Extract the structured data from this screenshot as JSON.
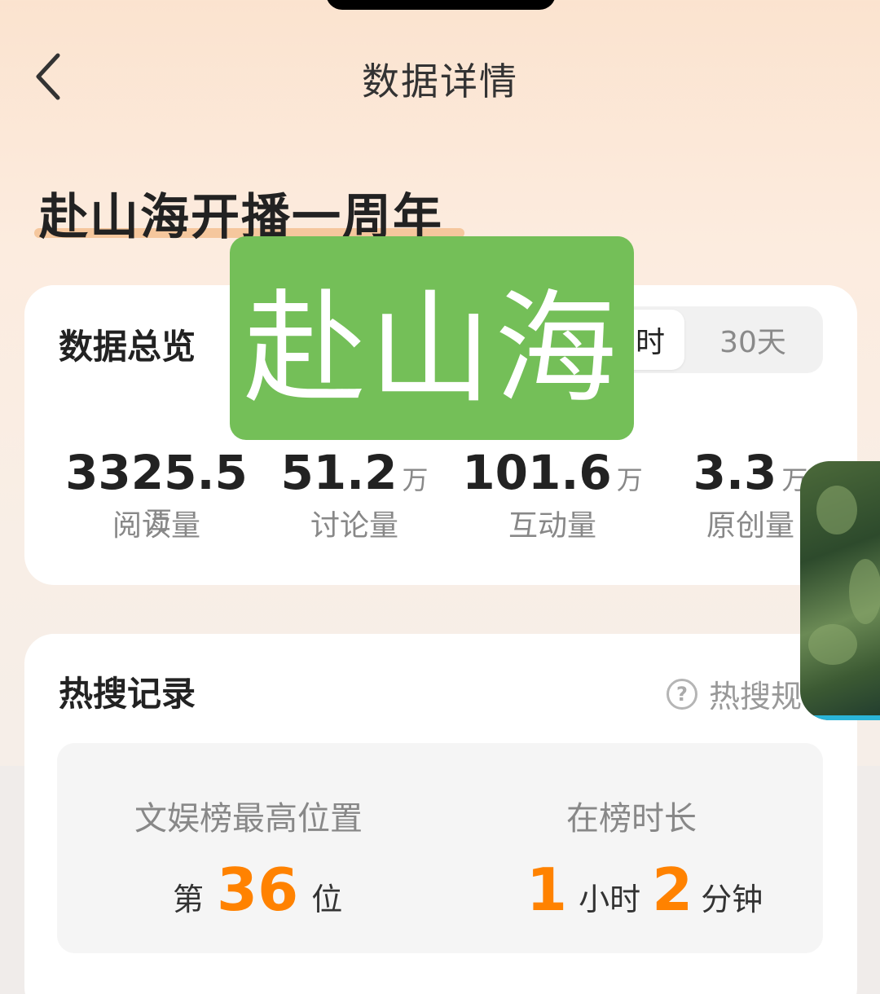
{
  "header": {
    "title": "数据详情"
  },
  "topic": {
    "title": "赴山海开播一周年"
  },
  "overview": {
    "title": "数据总览",
    "toggle": {
      "active_label": "时",
      "inactive_label": "30天"
    },
    "stats": [
      {
        "value": "3325.5",
        "unit": "万",
        "label": "阅读量"
      },
      {
        "value": "51.2",
        "unit": "万",
        "label": "讨论量"
      },
      {
        "value": "101.6",
        "unit": "万",
        "label": "互动量"
      },
      {
        "value": "3.3",
        "unit": "万",
        "label": "原创量"
      }
    ]
  },
  "hot_search": {
    "title": "热搜记录",
    "help_label": "热搜规",
    "rank_label": "文娱榜最高位置",
    "rank_prefix": "第",
    "rank_value": "36",
    "rank_suffix": "位",
    "duration_label": "在榜时长",
    "duration_hours": "1",
    "duration_hours_unit": "小时",
    "duration_minutes": "2",
    "duration_minutes_unit": "分钟"
  },
  "watermark": {
    "text": "赴山海"
  },
  "colors": {
    "accent_orange": "#ff8200",
    "watermark_green": "#74bf58"
  }
}
